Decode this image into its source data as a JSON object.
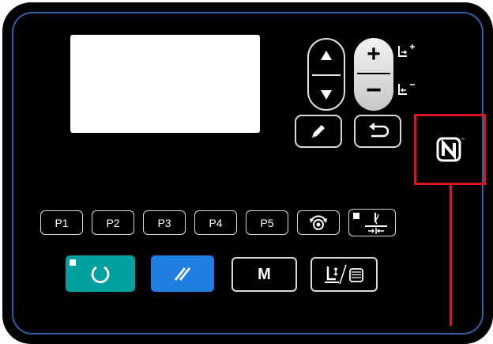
{
  "panel": {
    "pattern_buttons": [
      "P1",
      "P2",
      "P3",
      "P4",
      "P5"
    ],
    "mode_button_label": "M"
  },
  "colors": {
    "panel": "#000000",
    "panel_border": "#2f5fa8",
    "ready_button": "#00a0a0",
    "reset_button": "#1e7fe0",
    "highlight_box": "#e0141c"
  },
  "icons": {
    "up": "triangle-up",
    "down": "triangle-down",
    "plus": "+",
    "minus": "−",
    "edit": "pencil",
    "return": "return-arrow",
    "nfc": "nfc-n-mark",
    "winder": "bobbin-winder",
    "thread_clamp": "needle-thread",
    "ready": "circle",
    "reset": "double-slash",
    "threading": "presser-thread"
  }
}
